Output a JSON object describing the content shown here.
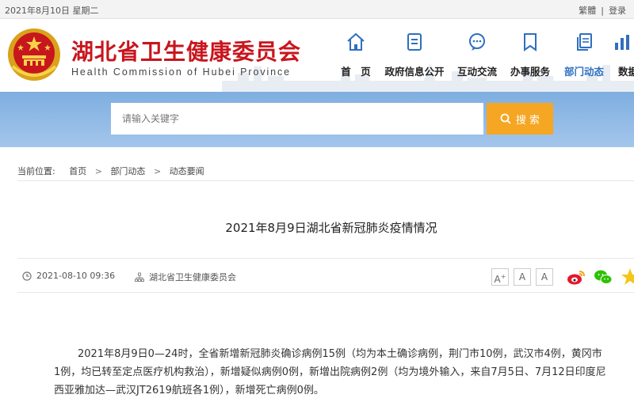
{
  "topbar": {
    "date": "2021年8月10日 星期二",
    "traditional": "繁體",
    "login": "登录"
  },
  "header": {
    "title": "湖北省卫生健康委员会",
    "subtitle": "Health Commission of Hubei Province"
  },
  "nav": {
    "items": [
      {
        "label": "首　页",
        "icon": "home-icon"
      },
      {
        "label": "政府信息公开",
        "icon": "document-icon"
      },
      {
        "label": "互动交流",
        "icon": "chat-icon"
      },
      {
        "label": "办事服务",
        "icon": "bookmark-icon"
      },
      {
        "label": "部门动态",
        "icon": "pages-icon"
      },
      {
        "label": "数据",
        "icon": "data-icon"
      }
    ],
    "active": "部门动态"
  },
  "search": {
    "placeholder": "请输入关键字",
    "button": "搜 索"
  },
  "breadcrumb": {
    "prefix": "当前位置:",
    "items": [
      "首页",
      "部门动态",
      "动态要闻"
    ]
  },
  "article": {
    "title": "2021年8月9日湖北省新冠肺炎疫情情况",
    "datetime": "2021-08-10 09:36",
    "source": "湖北省卫生健康委员会",
    "font_buttons": [
      "A",
      "A",
      "A"
    ],
    "share": [
      "weibo-icon",
      "wechat-icon",
      "favorite-icon"
    ],
    "body": "2021年8月9日0—24时，全省新增新冠肺炎确诊病例15例（均为本土确诊病例，荆门市10例，武汉市4例，黄冈市1例，均已转至定点医疗机构救治），新增疑似病例0例，新增出院病例2例（均为境外输入，来自7月5日、7月12日印度尼西亚雅加达—武汉JT2619航班各1例），新增死亡病例0例。"
  },
  "colors": {
    "brand_red": "#c8161d",
    "nav_active": "#2f6fbf",
    "search_button": "#f5a623",
    "band": "#8db8e6"
  }
}
